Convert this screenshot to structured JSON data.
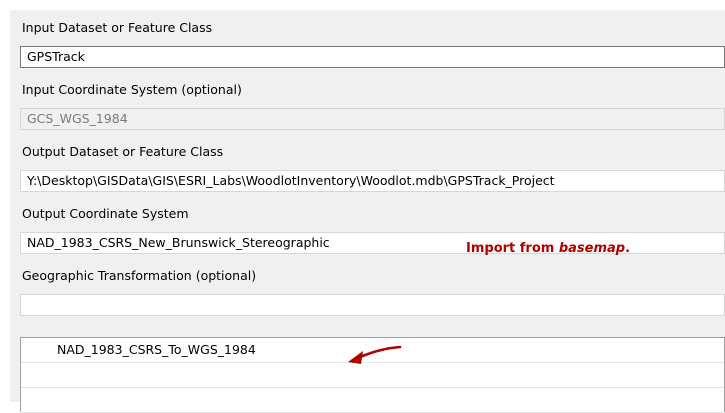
{
  "form": {
    "input_dataset": {
      "label": "Input Dataset or Feature Class",
      "value": "GPSTrack"
    },
    "input_coord": {
      "label": "Input Coordinate System (optional)",
      "value": "GCS_WGS_1984"
    },
    "output_dataset": {
      "label": "Output Dataset or Feature Class",
      "value": "Y:\\Desktop\\GISData\\GIS\\ESRI_Labs\\WoodlotInventory\\Woodlot.mdb\\GPSTrack_Project"
    },
    "output_coord": {
      "label": "Output Coordinate System",
      "value": "NAD_1983_CSRS_New_Brunswick_Stereographic"
    },
    "geo_transform": {
      "label": "Geographic Transformation (optional)",
      "value": "",
      "list_items": [
        "NAD_1983_CSRS_To_WGS_1984",
        "",
        ""
      ]
    }
  },
  "annotation": {
    "prefix": "Import from ",
    "emphasis": "basemap",
    "suffix": ".",
    "color": "#b00000"
  },
  "arrow_icon": "curved-arrow-left-icon"
}
